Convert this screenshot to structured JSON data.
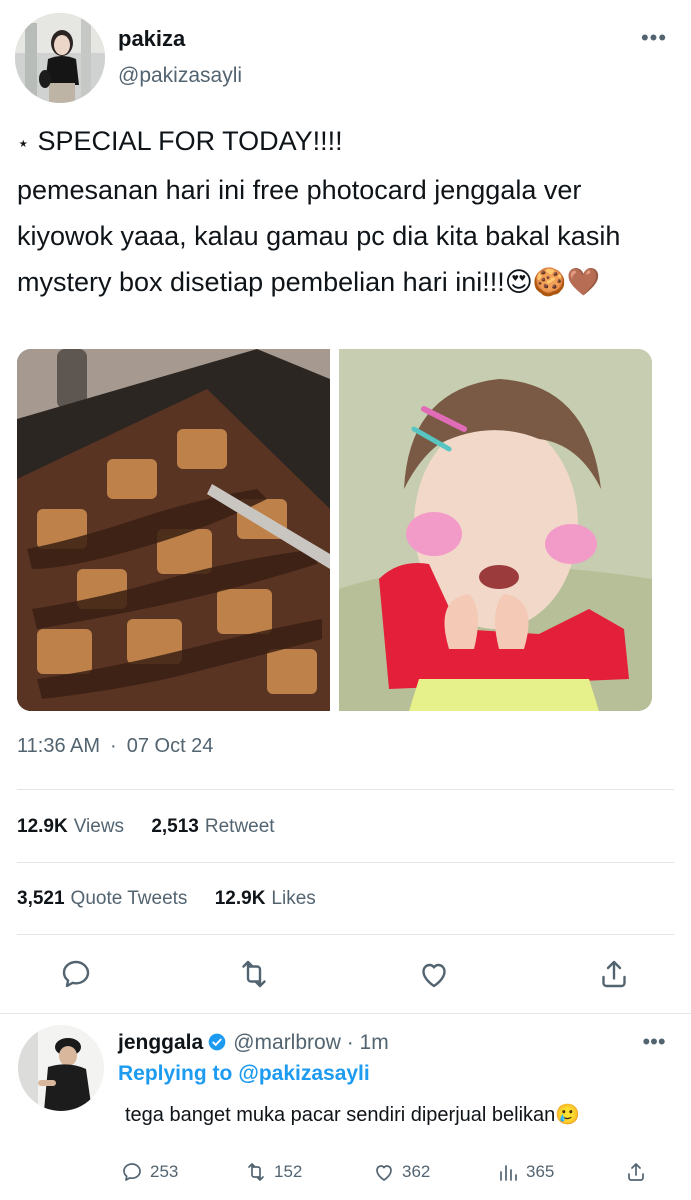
{
  "tweet": {
    "author": {
      "name": "pakiza",
      "handle": "@pakizasayli"
    },
    "more_label": "•••",
    "text": {
      "line1_symbol": "⋆",
      "line1": "SPECIAL FOR TODAY!!!!",
      "line2": "pemesanan hari ini free photocard jenggala ver",
      "line3": "kiyowok yaaa, kalau gamau pc dia kita bakal kasih",
      "line4": "mystery box disetiap pembelian hari ini!!!😍🍪🤎"
    },
    "time": "11:36 AM",
    "date": "07 Oct 24",
    "stats": {
      "views_count": "12.9K",
      "views_label": "Views",
      "retweet_count": "2,513",
      "retweet_label": "Retweet",
      "quote_count": "3,521",
      "quote_label": "Quote Tweets",
      "likes_count": "12.9K",
      "likes_label": "Likes"
    },
    "actions": [
      "reply-icon",
      "retweet-icon",
      "like-icon",
      "share-icon"
    ]
  },
  "reply": {
    "name": "jenggala",
    "handle": "@marlbrow",
    "time": "1m",
    "more_label": "•••",
    "replying_label": "Replying to",
    "replying_to": "@pakizasayli",
    "text": "tega banget muka pacar sendiri diperjual belikan🥲",
    "counts": {
      "replies": "253",
      "retweets": "152",
      "likes": "362",
      "views": "365"
    }
  },
  "colors": {
    "text_primary": "#0f1419",
    "text_secondary": "#536471",
    "accent": "#1d9bf0",
    "divider": "#e1e6ea"
  }
}
